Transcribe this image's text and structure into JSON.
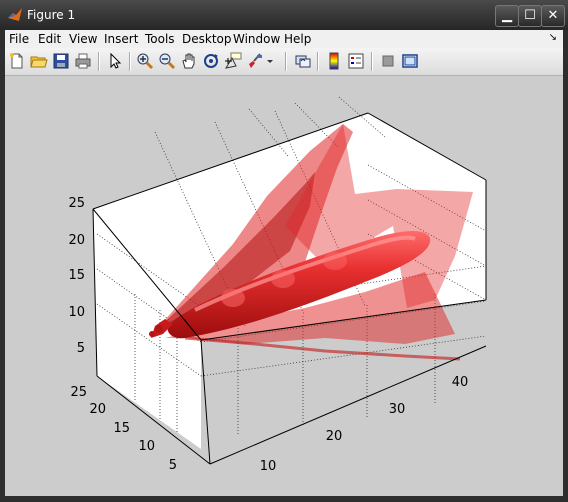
{
  "window": {
    "title": "Figure 1",
    "controls": {
      "minimize": "▁",
      "maximize": "☐",
      "close": "✕"
    }
  },
  "menu": [
    "File",
    "Edit",
    "View",
    "Insert",
    "Tools",
    "Desktop",
    "Window",
    "Help"
  ],
  "toolbar": [
    "new-figure-icon",
    "open-file-icon",
    "save-icon",
    "print-icon",
    "edit-plot-arrow-icon",
    "zoom-in-icon",
    "zoom-out-icon",
    "pan-hand-icon",
    "rotate-3d-icon",
    "data-cursor-icon",
    "brush-icon",
    "brush-dropdown-icon",
    "link-plot-icon",
    "colorbar-icon",
    "legend-icon",
    "hide-plot-tools-icon",
    "show-plot-tools-icon"
  ],
  "plot": {
    "z_ticks": [
      "5",
      "10",
      "15",
      "20",
      "25"
    ],
    "y_ticks": [
      "5",
      "10",
      "15",
      "20",
      "25"
    ],
    "x_ticks": [
      "10",
      "20",
      "30",
      "40"
    ],
    "surface_color": "#e02424"
  }
}
